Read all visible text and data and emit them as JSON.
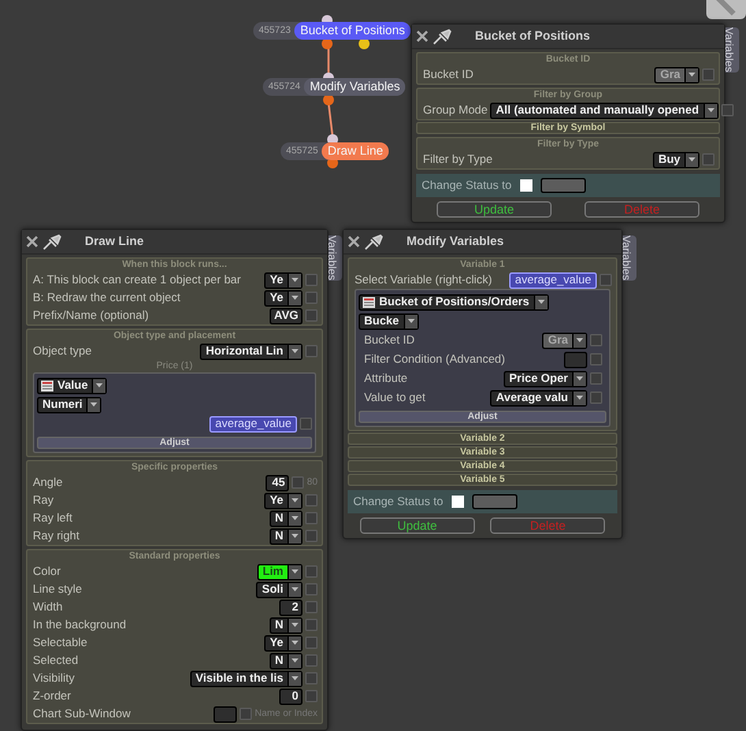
{
  "canvas": {
    "nodes": [
      {
        "id": "455723",
        "label": "Bucket of Positions",
        "color": "#5a5af5"
      },
      {
        "id": "455724",
        "label": "Modify Variables",
        "color": "#5b5b68"
      },
      {
        "id": "455725",
        "label": "Draw Line",
        "color": "#f27a4e"
      }
    ]
  },
  "windows": [
    {
      "title": "Bucket of Positions",
      "side_tab": "Variables",
      "blocks": [
        {
          "kind": "section",
          "title": "Bucket ID",
          "items": [
            {
              "label": "Bucket ID",
              "kind": "locked",
              "value": "Gra",
              "checked": false
            }
          ]
        },
        {
          "kind": "section",
          "title": "Filter by Group",
          "items": [
            {
              "label": "Group Mode",
              "kind": "select",
              "value": "All (automated and manually opened",
              "checked": false
            }
          ]
        },
        {
          "kind": "bar",
          "title": "Filter by Symbol"
        },
        {
          "kind": "section",
          "title": "Filter by Type",
          "items": [
            {
              "label": "Filter by Type",
              "kind": "select",
              "value": "Buy",
              "checked": false
            }
          ]
        },
        {
          "kind": "status",
          "label": "Change Status to",
          "checked": false
        },
        {
          "kind": "buttons",
          "items": [
            "Update",
            "Delete"
          ]
        }
      ]
    },
    {
      "title": "Draw Line",
      "side_tab": "Variables",
      "blocks": [
        {
          "kind": "section",
          "title": "When this block runs...",
          "items": [
            {
              "label": "A: This block can create 1 object per bar",
              "kind": "select",
              "value": "Ye",
              "checked": false
            },
            {
              "label": "B: Redraw the current object",
              "kind": "select",
              "value": "Ye",
              "checked": false
            },
            {
              "label": "Prefix/Name (optional)",
              "kind": "input",
              "value": "AVG",
              "checked": false
            }
          ]
        },
        {
          "kind": "section",
          "title": "Object type and placement",
          "items": [
            {
              "label": "Object type",
              "kind": "select",
              "value": "Horizontal Lin",
              "checked": false
            },
            {
              "kind": "subtitle",
              "text": "Price (1)"
            },
            {
              "kind": "subpanel",
              "items": [
                {
                  "kind": "iconselect",
                  "value": "Value"
                },
                {
                  "kind": "select",
                  "value": "Numeri"
                },
                {
                  "kind": "chip",
                  "value": "average_value",
                  "checked": false
                },
                {
                  "kind": "adjust",
                  "text": "Adjust"
                }
              ]
            }
          ]
        },
        {
          "kind": "section",
          "title": "Specific properties",
          "items": [
            {
              "label": "Angle",
              "kind": "input",
              "value": "45",
              "checked": false,
              "note": "80"
            },
            {
              "label": "Ray",
              "kind": "select",
              "value": "Ye",
              "checked": false
            },
            {
              "label": "Ray left",
              "kind": "select",
              "value": "N",
              "checked": false
            },
            {
              "label": "Ray right",
              "kind": "select",
              "value": "N",
              "checked": false
            }
          ]
        },
        {
          "kind": "section",
          "title": "Standard properties",
          "items": [
            {
              "label": "Color",
              "kind": "swatch",
              "value": "Lim",
              "color": "#22ee11",
              "checked": false
            },
            {
              "label": "Line style",
              "kind": "select",
              "value": "Soli",
              "checked": false
            },
            {
              "label": "Width",
              "kind": "input",
              "value": "2",
              "checked": false
            },
            {
              "label": "In the background",
              "kind": "select",
              "value": "N",
              "checked": false
            },
            {
              "label": "Selectable",
              "kind": "select",
              "value": "Ye",
              "checked": false
            },
            {
              "label": "Selected",
              "kind": "select",
              "value": "N",
              "checked": false
            },
            {
              "label": "Visibility",
              "kind": "select",
              "value": "Visible in the lis",
              "checked": false
            },
            {
              "label": "Z-order",
              "kind": "input",
              "value": "0",
              "checked": false
            },
            {
              "label": "Chart Sub-Window",
              "kind": "input",
              "checked": false,
              "note": "Name or Index"
            }
          ]
        }
      ]
    },
    {
      "title": "Modify Variables",
      "side_tab": "Variables",
      "blocks": [
        {
          "kind": "section",
          "title": "Variable 1",
          "items": [
            {
              "label": "Select Variable (right-click)",
              "kind": "chip",
              "value": "average_value",
              "checked": false
            },
            {
              "kind": "subpanel",
              "items": [
                {
                  "kind": "iconselect",
                  "value": "Bucket of Positions/Orders"
                },
                {
                  "kind": "select",
                  "value": "Bucke"
                },
                {
                  "label": "Bucket ID",
                  "kind": "locked",
                  "value": "Gra",
                  "checked": false
                },
                {
                  "label": "Filter Condition (Advanced)",
                  "kind": "input",
                  "checked": false
                },
                {
                  "label": "Attribute",
                  "kind": "select",
                  "value": "Price Oper",
                  "checked": false
                },
                {
                  "label": "Value to get",
                  "kind": "select",
                  "value": "Average valu",
                  "checked": false
                },
                {
                  "kind": "adjust",
                  "text": "Adjust"
                }
              ]
            }
          ]
        },
        {
          "kind": "bar",
          "title": "Variable 2"
        },
        {
          "kind": "bar",
          "title": "Variable 3"
        },
        {
          "kind": "bar",
          "title": "Variable 4"
        },
        {
          "kind": "bar",
          "title": "Variable 5"
        },
        {
          "kind": "status",
          "label": "Change Status to",
          "checked": false
        },
        {
          "kind": "buttons",
          "items": [
            "Update",
            "Delete"
          ]
        }
      ]
    }
  ]
}
